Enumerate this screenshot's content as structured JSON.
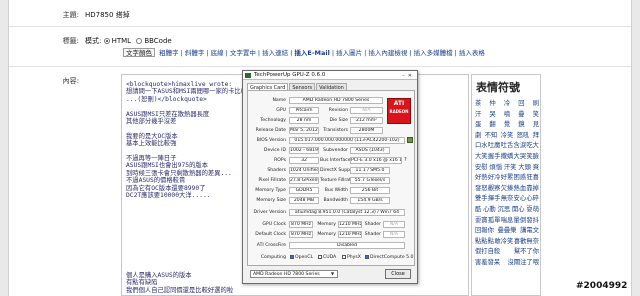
{
  "form": {
    "subject_label": "主題:",
    "subject_value": "HD7850 搭掉",
    "tag_label": "標籤:",
    "mode_label": "模式:",
    "mode_html": "HTML",
    "mode_bbcode": "BBCode",
    "content_label": "內容:"
  },
  "toolbar": {
    "font_color_select": "文字顏色",
    "items": [
      "粗體字",
      "斜體字",
      "底線",
      "文字置中",
      "插入連結",
      "插入E-Mail",
      "插入圖片",
      "插入內建檢視",
      "插入多媒體檔",
      "插入表格"
    ]
  },
  "post": {
    "lines": [
      "<blockquote>himaxlive wrote:",
      "想請問一下ASUS和MSI兩間哪一家的卡比較優",
      "...(恕刪)</blockquote>",
      "",
      "ASUS跟MSI只差在散熱器長度",
      "其他部分幾乎沒差",
      "",
      "我要的是大OC版本",
      "基本上效能比較強",
      "",
      "不過再等一陣日子",
      "ASUS跟MSI也會出975的版本",
      "到時候三張卡會只剩散熱器的差異...",
      "不過ASUS的價格較貴",
      "因為它有OC版本還要8990了",
      "DC2T應該要10000大洋....."
    ],
    "lines_bottom": [
      "個人是購入ASUS的版本",
      "有點有缺陷",
      "我們個人自己認同價還是比較好選的啦"
    ]
  },
  "sidebar": {
    "title": "表情符號",
    "emoticons": [
      [
        "茶",
        "仲",
        "冷",
        "回",
        "刷"
      ],
      [
        "汗",
        "哭",
        "噴",
        "疊",
        "笑"
      ],
      [
        "蛋",
        "翻",
        "覺",
        "鏡",
        "見"
      ],
      [
        "劇",
        "不知",
        "冷笑",
        "怒吼",
        "拜"
      ],
      [
        "口水",
        "吐魔",
        "吐舌",
        "含淚",
        "吃大"
      ],
      [
        "大笑",
        "握手",
        "撒嬌",
        "大哭",
        "笑臉"
      ],
      [
        "安慰",
        "煩惱",
        "汗笑",
        "大頭",
        "爽"
      ],
      [
        "好熱",
        "好冷",
        "好累",
        "困惑",
        "狂喜"
      ],
      [
        "發怒",
        "觀察",
        "欠揍",
        "熱血",
        "靠掉"
      ],
      [
        "雙手",
        "揮手",
        "無奈",
        "安心",
        "心碎"
      ],
      [
        "酷",
        "心動",
        "沉思",
        "開心",
        "耍萌"
      ],
      [
        "耍寶",
        "孤單",
        "喘息",
        "暈倒",
        "發抖"
      ],
      [
        "回報你",
        "疊疊樂",
        "講電文"
      ],
      [
        "點點點",
        "敢冷笑",
        "喜歡無奈"
      ],
      [
        "假打自殺",
        "幫不了你"
      ],
      [
        "害羞發呆",
        "沒關注了喂"
      ]
    ]
  },
  "gpuz": {
    "title": "TechPowerUp GPU-Z 0.6.0",
    "tabs": [
      "Graphics Card",
      "Sensors",
      "Validation"
    ],
    "name_label": "Name",
    "name_value": "AMD Radeon HD 7800 Series",
    "gpu_label": "GPU",
    "gpu_value": "Pitcairn",
    "revision_label": "Revision",
    "revision_value": "N/A",
    "technology_label": "Technology",
    "technology_value": "28 nm",
    "die_size_label": "Die Size",
    "die_size_value": "212 mm²",
    "release_label": "Release Date",
    "release_value": "Mar 5, 2012",
    "transistors_label": "Transistors",
    "transistors_value": "2800M",
    "bios_label": "BIOS Version",
    "bios_value": "015.017.000.000.000000 (113-AC42200-102)",
    "device_label": "Device ID",
    "device_value": "1002 - 6819",
    "subvendor_label": "Subvendor",
    "subvendor_value": "ASUS (1043)",
    "rops_label": "ROPs",
    "rops_value": "32",
    "bus_label": "Bus Interface",
    "bus_value": "PCI-E 3.0 x16 @ x16 1.1",
    "shaders_label": "Shaders",
    "shaders_value": "1024 Unified",
    "directx_label": "DirectX Support",
    "directx_value": "11.1 / SM5.0",
    "pixel_label": "Pixel Fillrate",
    "pixel_value": "27.8 GPixel/s",
    "texture_label": "Texture Fillrate",
    "texture_value": "55.7 GTexel/s",
    "memtype_label": "Memory Type",
    "memtype_value": "GDDR5",
    "buswidth_label": "Bus Width",
    "buswidth_value": "256 Bit",
    "memsize_label": "Memory Size",
    "memsize_value": "2048 MB",
    "bandwidth_label": "Bandwidth",
    "bandwidth_value": "154.9 GB/s",
    "driver_label": "Driver Version",
    "driver_value": "atiumdag 8.951.0.0 (Catalyst 12.3) / Win7 64",
    "gpuclock_label": "GPU Clock",
    "gpuclock_value": "870 MHz",
    "memory_label": "Memory",
    "memory_value": "1210 MHz",
    "shader_label": "Shader",
    "shader_value": "N/A",
    "defclock_label": "Default Clock",
    "defclock_value": "870 MHz",
    "defmem_value": "1210 MHz",
    "defshader_value": "N/A",
    "crossfire_label": "ATI CrossFire",
    "crossfire_value": "Disabled",
    "computing_label": "Computing",
    "opencl": "OpenCL",
    "cuda": "CUDA",
    "physx": "PhysX",
    "directcompute": "DirectCompute 5.0",
    "logo_text": "ATI",
    "logo_sub": "RADEON",
    "dropdown_value": "AMD Radeon HD 7800 Series",
    "close_label": "Close"
  },
  "watermark": "#2004992"
}
